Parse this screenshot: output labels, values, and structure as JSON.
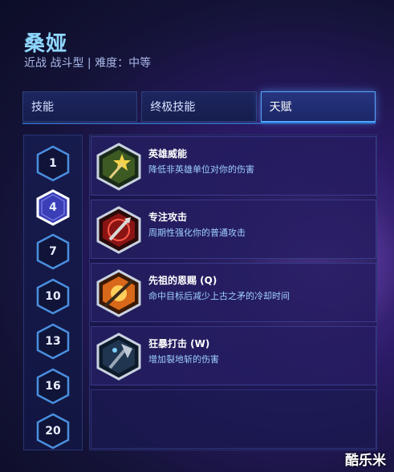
{
  "hero": {
    "name": "桑娅",
    "subtitle": "近战 战斗型 | 难度：中等"
  },
  "tabs": [
    {
      "label": "技能",
      "active": false
    },
    {
      "label": "终极技能",
      "active": false
    },
    {
      "label": "天赋",
      "active": true
    }
  ],
  "levels": [
    {
      "label": "1",
      "selected": false
    },
    {
      "label": "4",
      "selected": true
    },
    {
      "label": "7",
      "selected": false
    },
    {
      "label": "10",
      "selected": false
    },
    {
      "label": "13",
      "selected": false
    },
    {
      "label": "16",
      "selected": false
    },
    {
      "label": "20",
      "selected": false
    }
  ],
  "talents": [
    {
      "title": "英雄威能",
      "desc": "降低非英雄单位对你的伤害",
      "icon": "heroic-might-icon"
    },
    {
      "title": "专注攻击",
      "desc": "周期性强化你的普通攻击",
      "icon": "focused-attack-icon"
    },
    {
      "title": "先祖的恩赐 (Q)",
      "desc": "命中目标后减少上古之矛的冷却时间",
      "icon": "ancients-blessing-icon"
    },
    {
      "title": "狂暴打击 (W)",
      "desc": "增加裂地斩的伤害",
      "icon": "frenzied-strike-icon"
    }
  ],
  "watermark": "酷乐米",
  "colors": {
    "accent": "#3aa6ff",
    "hex_border": "#4a8fe0",
    "selected_hex": "#ffffff"
  }
}
